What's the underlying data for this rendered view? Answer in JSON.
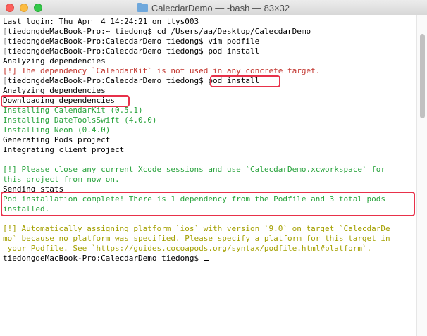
{
  "window": {
    "title": "CalecdarDemo — -bash — 83×32"
  },
  "terminal": {
    "lines": [
      {
        "text": "Last login: Thu Apr  4 14:24:21 on ttys003",
        "color": "default",
        "bracket": false
      },
      {
        "text": "tiedongdeMacBook-Pro:~ tiedong$ cd /Users/aa/Desktop/CalecdarDemo",
        "color": "default",
        "bracket": true
      },
      {
        "text": "tiedongdeMacBook-Pro:CalecdarDemo tiedong$ vim podfile",
        "color": "default",
        "bracket": true
      },
      {
        "text": "tiedongdeMacBook-Pro:CalecdarDemo tiedong$ pod install",
        "color": "default",
        "bracket": true
      },
      {
        "text": "Analyzing dependencies",
        "color": "default",
        "bracket": false
      },
      {
        "text": "[!] The dependency `CalendarKit` is not used in any concrete target.",
        "color": "red",
        "bracket": false
      },
      {
        "text": "tiedongdeMacBook-Pro:CalecdarDemo tiedong$ pod install",
        "color": "default",
        "bracket": true
      },
      {
        "text": "Analyzing dependencies",
        "color": "default",
        "bracket": false
      },
      {
        "text": "Downloading dependencies",
        "color": "default",
        "bracket": false
      },
      {
        "text": "Installing CalendarKit (0.5.1)",
        "color": "green",
        "bracket": false
      },
      {
        "text": "Installing DateToolsSwift (4.0.0)",
        "color": "green",
        "bracket": false
      },
      {
        "text": "Installing Neon (0.4.0)",
        "color": "green",
        "bracket": false
      },
      {
        "text": "Generating Pods project",
        "color": "default",
        "bracket": false
      },
      {
        "text": "Integrating client project",
        "color": "default",
        "bracket": false
      },
      {
        "text": "",
        "color": "default",
        "bracket": false
      },
      {
        "text": "[!] Please close any current Xcode sessions and use `CalecdarDemo.xcworkspace` for",
        "color": "green",
        "bracket": false
      },
      {
        "text": "this project from now on.",
        "color": "green",
        "bracket": false
      },
      {
        "text": "Sending stats",
        "color": "default",
        "bracket": false
      },
      {
        "text": "Pod installation complete! There is 1 dependency from the Podfile and 3 total pods",
        "color": "green",
        "bracket": false
      },
      {
        "text": "installed.",
        "color": "green",
        "bracket": false
      },
      {
        "text": "",
        "color": "default",
        "bracket": false
      },
      {
        "text": "[!] Automatically assigning platform `ios` with version `9.0` on target `CalecdarDe",
        "color": "olive",
        "bracket": false
      },
      {
        "text": "mo` because no platform was specified. Please specify a platform for this target in",
        "color": "olive",
        "bracket": false
      },
      {
        "text": " your Podfile. See `https://guides.cocoapods.org/syntax/podfile.html#platform`.",
        "color": "olive",
        "bracket": false
      },
      {
        "text": "tiedongdeMacBook-Pro:CalecdarDemo tiedong$ ",
        "color": "default",
        "bracket": false,
        "cursor": true
      }
    ]
  },
  "colors": {
    "red": "#c2342d",
    "green": "#28a33c",
    "olive": "#a4a000",
    "highlight": "#e8314a"
  },
  "icons": {
    "title_icon": "folder-icon"
  }
}
